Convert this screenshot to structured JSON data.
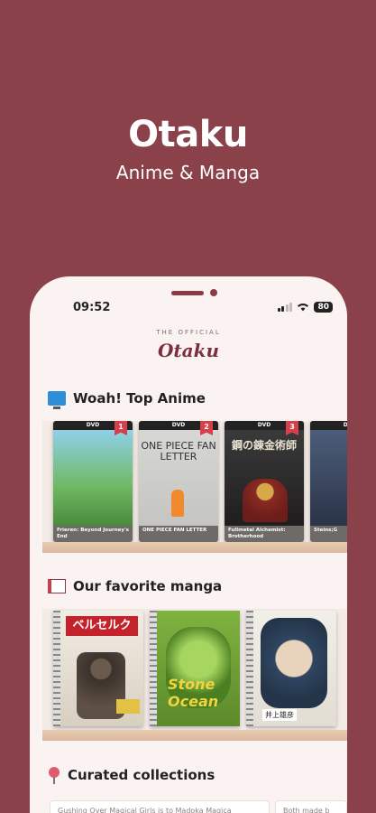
{
  "promo": {
    "title": "Otaku",
    "subtitle": "Anime & Manga"
  },
  "status_bar": {
    "time": "09:52",
    "battery": "80"
  },
  "brand": {
    "kicker": "THE OFFICIAL",
    "name": "Otaku"
  },
  "sections": {
    "top_anime": {
      "title": "Woah! Top Anime",
      "icon": "television-icon",
      "items": [
        {
          "rank": "1",
          "dvd": "DVD",
          "caption": "Frieren: Beyond Journey's End"
        },
        {
          "rank": "2",
          "dvd": "DVD",
          "caption": "ONE PIECE FAN LETTER",
          "art_text": "ONE PIECE FAN LETTER"
        },
        {
          "rank": "3",
          "dvd": "DVD",
          "caption": "Fullmetal Alchemist: Brotherhood",
          "art_text": "鋼の錬金術師"
        },
        {
          "rank": "",
          "dvd": "DVD",
          "caption": "Steins;G"
        }
      ]
    },
    "favorite_manga": {
      "title": "Our favorite manga",
      "icon": "open-book-icon",
      "items": [
        {
          "title_text": "ベルセルク"
        },
        {
          "title_text": "Stone Ocean"
        },
        {
          "title_text": "井上雄彦"
        }
      ]
    },
    "curated": {
      "title": "Curated collections",
      "icon": "pushpin-icon",
      "cards": [
        "Gushing Over Magical Girls is to Madoka Magica",
        "Both made b"
      ]
    }
  }
}
